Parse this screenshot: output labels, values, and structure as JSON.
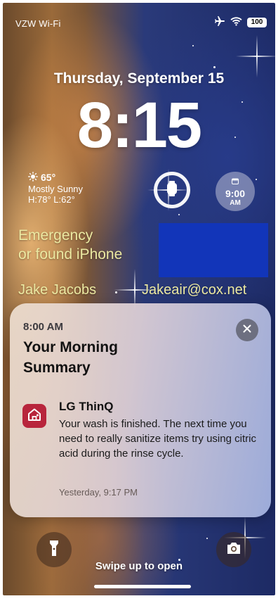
{
  "status_bar": {
    "carrier": "VZW Wi-Fi",
    "battery": "100",
    "icons": [
      "airplane-icon",
      "wifi-icon",
      "battery-icon"
    ]
  },
  "lock_screen": {
    "date": "Thursday, September 15",
    "time": "8:15"
  },
  "widgets": {
    "weather": {
      "temperature": "65°",
      "condition": "Mostly Sunny",
      "range": "H:78° L:62°",
      "icon": "sun-icon"
    },
    "watch_ring": {
      "icon": "watch-icon"
    },
    "clock": {
      "time": "9:00",
      "period": "AM",
      "icon": "calendar-icon"
    }
  },
  "owner_info": {
    "emergency_line1": "Emergency",
    "emergency_line2": "or found iPhone",
    "name": "Jake Jacobs",
    "email": "Jakeair@cox.net"
  },
  "notification": {
    "time": "8:00 AM",
    "heading": "Your Morning Summary",
    "app_name": "LG ThinQ",
    "app_icon": "home-icon",
    "message": "Your wash is finished. The next time you need to really sanitize items try using citric acid during the rinse cycle.",
    "message_time": "Yesterday, 9:17 PM",
    "close_icon": "close-icon"
  },
  "bottom": {
    "swipe_text": "Swipe up to open",
    "flashlight_icon": "flashlight-icon",
    "camera_icon": "camera-icon"
  },
  "colors": {
    "owner_text": "#ece9a2",
    "redaction": "#1235b9",
    "app_icon_bg": "#b8253c"
  }
}
